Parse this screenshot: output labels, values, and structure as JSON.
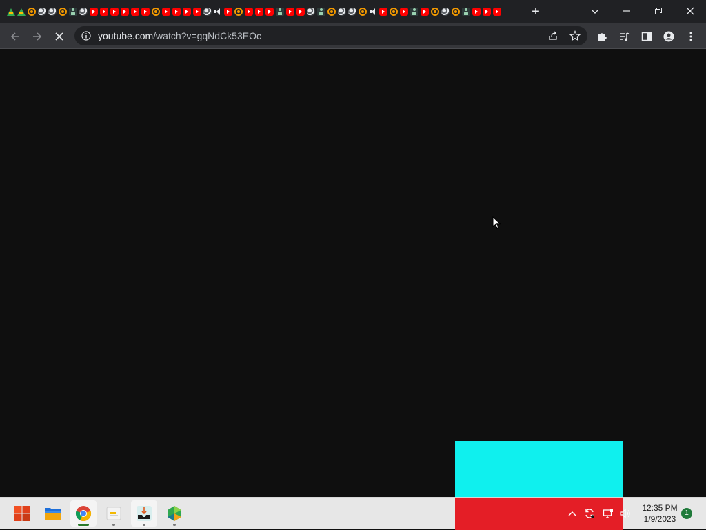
{
  "browser": {
    "tabs": [
      "drive",
      "drive",
      "orange",
      "swirl",
      "swirl",
      "orange",
      "person",
      "swirl",
      "yt",
      "yt",
      "yt",
      "yt",
      "yt",
      "yt",
      "orange",
      "yt",
      "yt",
      "yt",
      "yt",
      "swirl",
      "audio",
      "yt",
      "orange",
      "yt",
      "yt",
      "yt",
      "person",
      "yt",
      "yt",
      "swirl",
      "person",
      "orange",
      "swirl",
      "swirl",
      "orange",
      "audio",
      "yt",
      "orange",
      "yt",
      "person",
      "yt",
      "orange",
      "swirl",
      "orange",
      "person",
      "yt",
      "yt",
      "yt"
    ],
    "new_tab_label": "+",
    "url_host": "youtube.com",
    "url_path": "/watch?v=gqNdCk53EOc"
  },
  "taskbar": {
    "apps": [
      {
        "name": "start-button",
        "icon": "windows-logo-icon"
      },
      {
        "name": "file-explorer",
        "icon": "folder-icon"
      },
      {
        "name": "chrome",
        "icon": "chrome-icon"
      },
      {
        "name": "app-3",
        "icon": "document-app-icon"
      },
      {
        "name": "app-4",
        "icon": "inbox-app-icon"
      },
      {
        "name": "app-5",
        "icon": "gem-app-icon"
      }
    ],
    "time": "12:35 PM",
    "date": "1/9/2023",
    "notification_count": "1"
  },
  "colors": {
    "content_bg": "#0f0f0f",
    "cyan_block": "#0ff0ee",
    "red_block": "#e41e26"
  }
}
